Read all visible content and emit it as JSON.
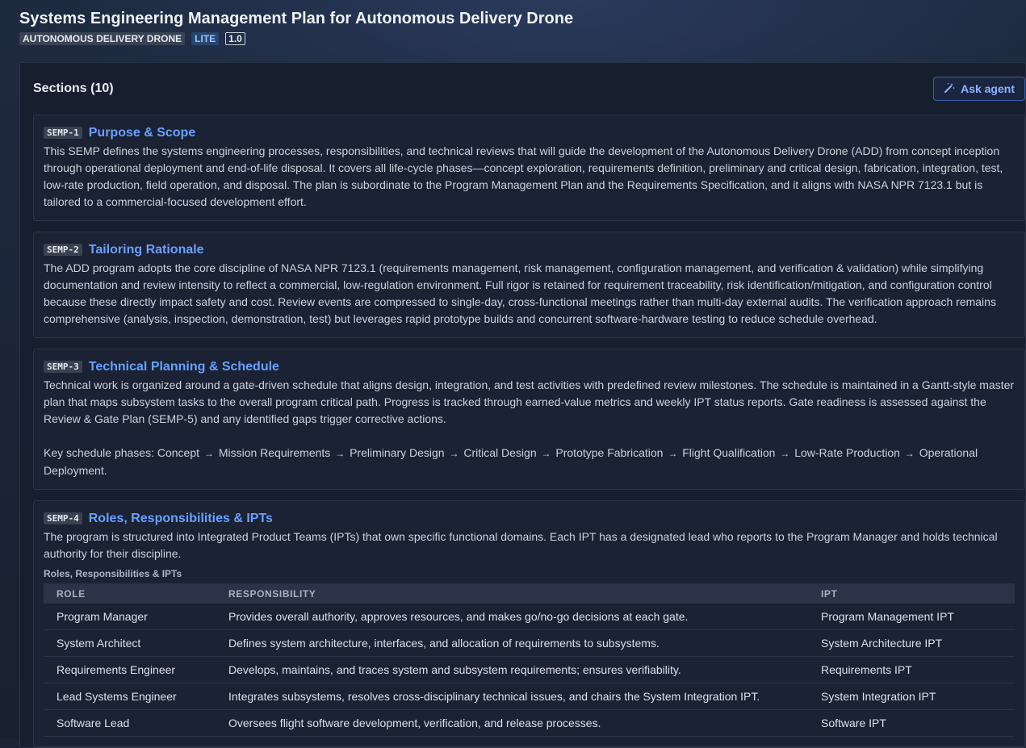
{
  "header": {
    "title": "Systems Engineering Management Plan for Autonomous Delivery Drone",
    "project_badge": "AUTONOMOUS DELIVERY DRONE",
    "tier_badge": "LITE",
    "version_badge": "1.0"
  },
  "panel": {
    "title": "Sections (10)",
    "ask_label": "Ask agent"
  },
  "sections": [
    {
      "id": "SEMP-1",
      "title": "Purpose & Scope",
      "body": "This SEMP defines the systems engineering processes, responsibilities, and technical reviews that will guide the development of the Autonomous Delivery Drone (ADD) from concept inception through operational deployment and end-of-life disposal. It covers all life-cycle phases—concept exploration, requirements definition, preliminary and critical design, fabrication, integration, test, low-rate production, field operation, and disposal. The plan is subordinate to the Program Management Plan and the Requirements Specification, and it aligns with NASA NPR 7123.1 but is tailored to a commercial-focused development effort."
    },
    {
      "id": "SEMP-2",
      "title": "Tailoring Rationale",
      "body": "The ADD program adopts the core discipline of NASA NPR 7123.1 (requirements management, risk management, configuration management, and verification & validation) while simplifying documentation and review intensity to reflect a commercial, low-regulation environment. Full rigor is retained for requirement traceability, risk identification/mitigation, and configuration control because these directly impact safety and cost. Review events are compressed to single-day, cross-functional meetings rather than multi-day external audits. The verification approach remains comprehensive (analysis, inspection, demonstration, test) but leverages rapid prototype builds and concurrent software-hardware testing to reduce schedule overhead."
    },
    {
      "id": "SEMP-3",
      "title": "Technical Planning & Schedule",
      "body": "Technical work is organized around a gate-driven schedule that aligns design, integration, and test activities with predefined review milestones. The schedule is maintained in a Gantt-style master plan that maps subsystem tasks to the overall program critical path. Progress is tracked through earned-value metrics and weekly IPT status reports. Gate readiness is assessed against the Review & Gate Plan (SEMP-5) and any identified gaps trigger corrective actions.",
      "phases_prefix": "Key schedule phases: ",
      "phases": [
        "Concept",
        "Mission Requirements",
        "Preliminary Design",
        "Critical Design",
        "Prototype Fabrication",
        "Flight Qualification",
        "Low-Rate Production",
        "Operational Deployment"
      ],
      "phases_suffix": ".",
      "arrow": "→"
    },
    {
      "id": "SEMP-4",
      "title": "Roles, Responsibilities & IPTs",
      "body": "The program is structured into Integrated Product Teams (IPTs) that own specific functional domains. Each IPT has a designated lead who reports to the Program Manager and holds technical authority for their discipline.",
      "table_caption": "Roles, Responsibilities & IPTs",
      "columns": [
        "ROLE",
        "RESPONSIBILITY",
        "IPT"
      ],
      "rows": [
        [
          "Program Manager",
          "Provides overall authority, approves resources, and makes go/no-go decisions at each gate.",
          "Program Management IPT"
        ],
        [
          "System Architect",
          "Defines system architecture, interfaces, and allocation of requirements to subsystems.",
          "System Architecture IPT"
        ],
        [
          "Requirements Engineer",
          "Develops, maintains, and traces system and subsystem requirements; ensures verifiability.",
          "Requirements IPT"
        ],
        [
          "Lead Systems Engineer",
          "Integrates subsystems, resolves cross-disciplinary technical issues, and chairs the System Integration IPT.",
          "System Integration IPT"
        ],
        [
          "Software Lead",
          "Oversees flight software development, verification, and release processes.",
          "Software IPT"
        ]
      ]
    }
  ]
}
